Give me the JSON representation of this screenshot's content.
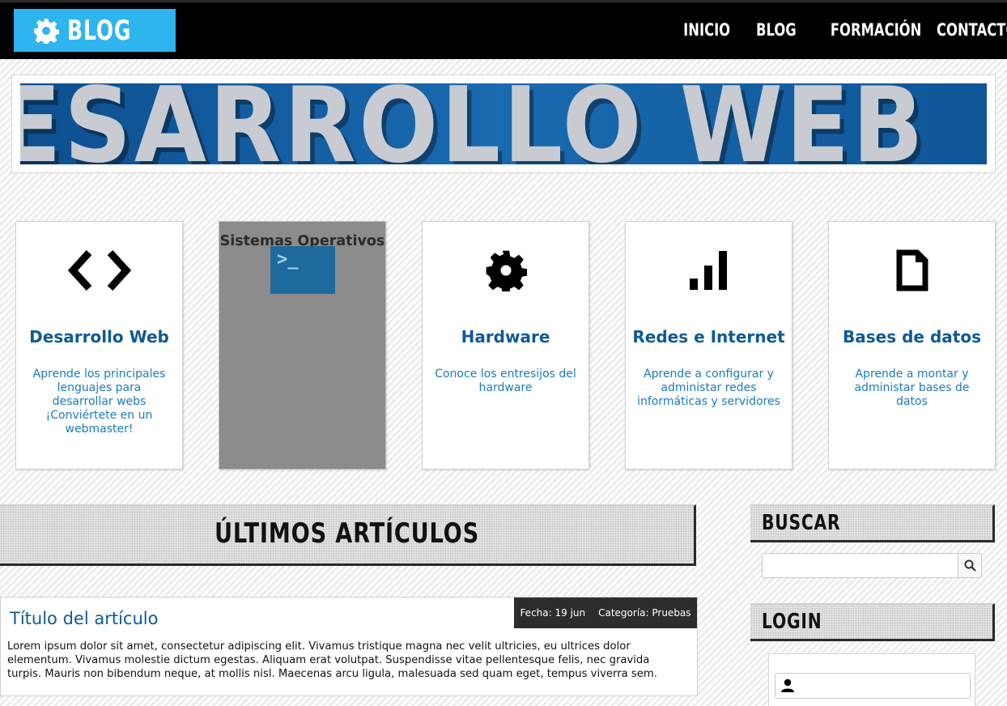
{
  "header": {
    "logo_text": "BLOG",
    "logo_icon": "gear-icon",
    "nav": [
      "INICIO",
      "BLOG",
      "FORMACIÓN",
      "CONTACTO"
    ]
  },
  "banner": {
    "text": "ESARROLLO WEB"
  },
  "categories": [
    {
      "title": "Desarrollo Web",
      "description": "Aprende los principales lenguajes para desarrollar webs ¡Conviértete en un webmaster!",
      "icon": "code-icon"
    },
    {
      "title": "Sistemas Operativos",
      "description": "",
      "icon": "terminal-icon",
      "icon_text": ">_"
    },
    {
      "title": "Hardware",
      "description": "Conoce los entresijos del hardware",
      "icon": "gear-icon"
    },
    {
      "title": "Redes e Internet",
      "description": "Aprende a configurar y administar redes informáticas y servidores",
      "icon": "signal-bars-icon"
    },
    {
      "title": "Bases de datos",
      "description": "Aprende a montar y administar bases de datos",
      "icon": "document-icon"
    }
  ],
  "main": {
    "section_title": "ÚLTIMOS ARTÍCULOS",
    "article": {
      "title": "Título del artículo",
      "date": "Fecha: 19 jun",
      "category": "Categoría: Pruebas",
      "body": "Lorem ipsum dolor sit amet, consectetur adipiscing elit. Vivamus tristique magna nec velit ultricies, eu ultrices dolor elementum. Vivamus molestie dictum egestas. Aliquam erat volutpat. Suspendisse vitae pellentesque felis, nec gravida turpis. Mauris non bibendum neque, at mollis nisl. Maecenas arcu ligula, malesuada sed quam eget, tempus viverra sem."
    }
  },
  "sidebar": {
    "search_title": "BUSCAR",
    "search_value": "",
    "login_title": "LOGIN",
    "username_value": ""
  },
  "colors": {
    "accent": "#2eb4ef",
    "link": "#0d5a96",
    "desc": "#1a7ac0",
    "topbar": "#000000"
  }
}
